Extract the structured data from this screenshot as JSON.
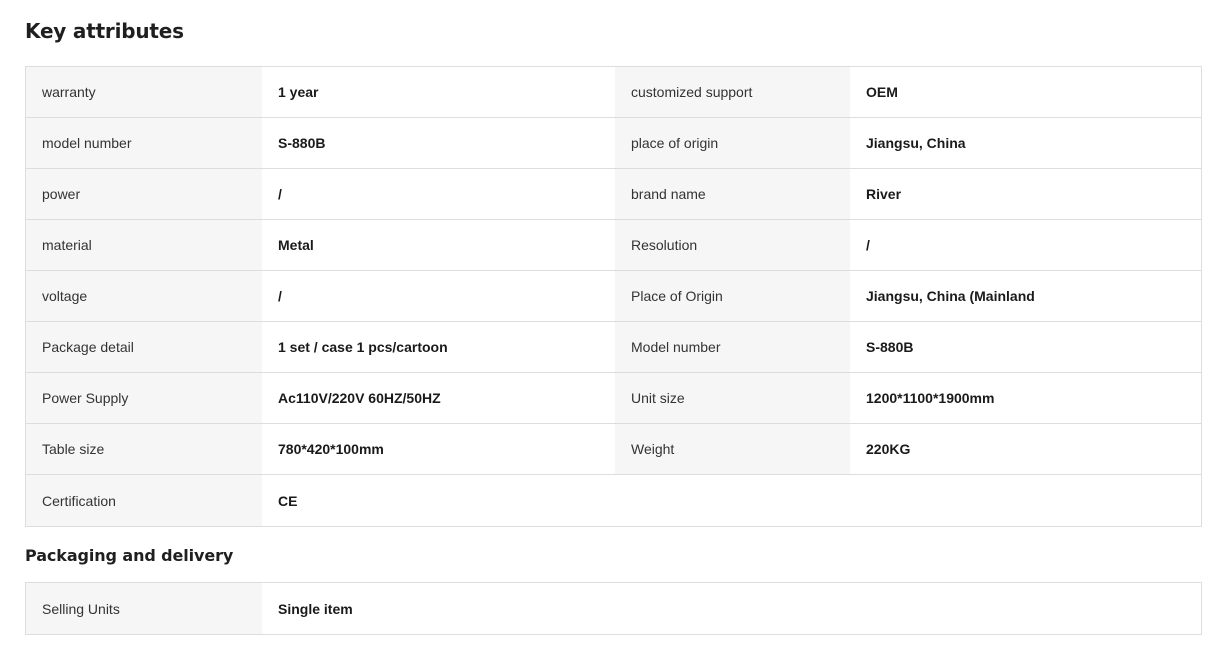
{
  "key_attributes": {
    "title": "Key attributes",
    "rows": [
      {
        "label1": "warranty",
        "value1": "1 year",
        "label2": "customized support",
        "value2": "OEM"
      },
      {
        "label1": "model number",
        "value1": "S-880B",
        "label2": "place of origin",
        "value2": "Jiangsu, China"
      },
      {
        "label1": "power",
        "value1": "/",
        "label2": "brand name",
        "value2": "River"
      },
      {
        "label1": "material",
        "value1": "Metal",
        "label2": "Resolution",
        "value2": "/"
      },
      {
        "label1": "voltage",
        "value1": "/",
        "label2": "Place of Origin",
        "value2": "Jiangsu, China (Mainland"
      },
      {
        "label1": "Package detail",
        "value1": "1 set / case 1 pcs/cartoon",
        "label2": "Model number",
        "value2": "S-880B"
      },
      {
        "label1": "Power Supply",
        "value1": "Ac110V/220V 60HZ/50HZ",
        "label2": "Unit size",
        "value2": "1200*1100*1900mm"
      },
      {
        "label1": "Table size",
        "value1": "780*420*100mm",
        "label2": "Weight",
        "value2": "220KG"
      },
      {
        "label1": "Certification",
        "value1": "CE"
      }
    ]
  },
  "packaging": {
    "title": "Packaging and delivery",
    "rows": [
      {
        "label": "Selling Units",
        "value": "Single item"
      }
    ]
  }
}
